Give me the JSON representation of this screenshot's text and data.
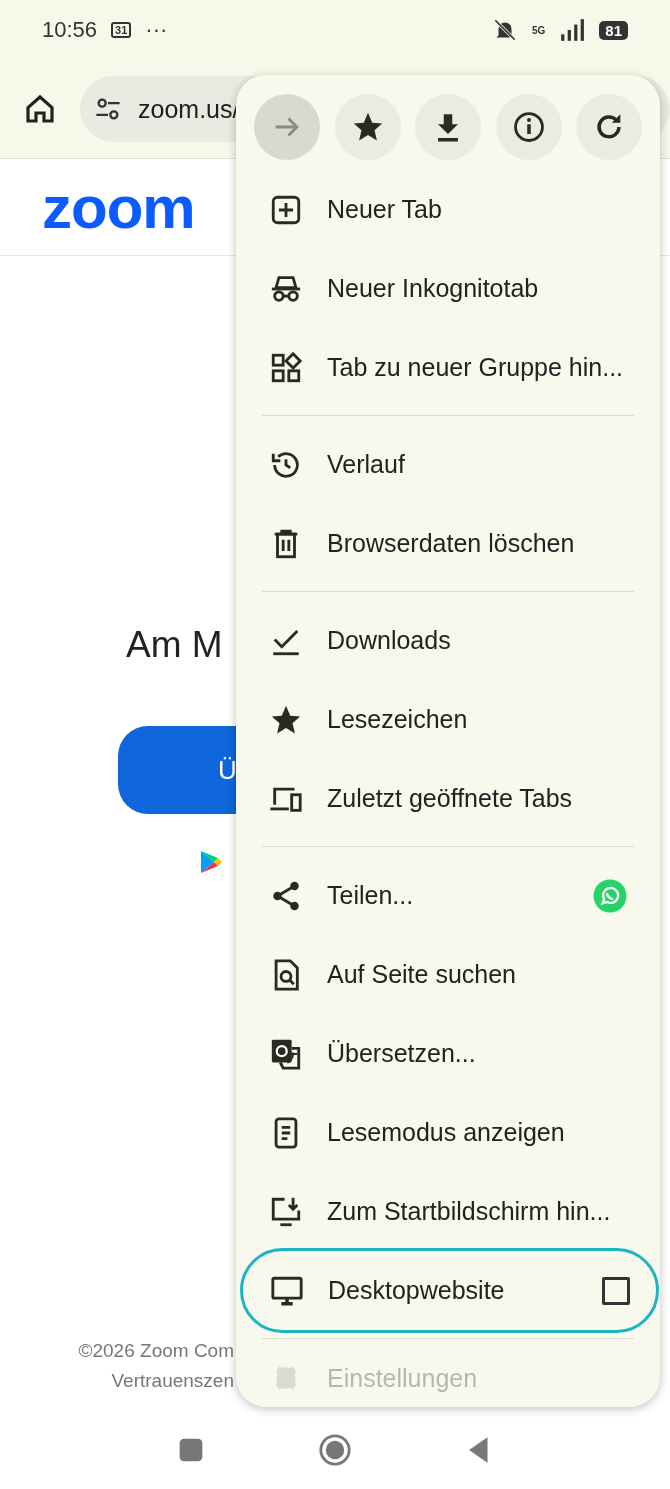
{
  "status_bar": {
    "time": "10:56",
    "calendar": "31",
    "more": "···",
    "network": "5G",
    "battery": "81"
  },
  "toolbar": {
    "url": "zoom.us/"
  },
  "page": {
    "logo": "zoom",
    "heading": "Am M",
    "button": "Ü",
    "footer": [
      "©2026 Zoom Com",
      "Vertrauenszen"
    ]
  },
  "menu": {
    "actions": [
      {
        "kind": "forward",
        "disabled": true
      },
      {
        "kind": "star",
        "disabled": false
      },
      {
        "kind": "download",
        "disabled": false
      },
      {
        "kind": "info",
        "disabled": false
      },
      {
        "kind": "reload",
        "disabled": false
      }
    ],
    "items": [
      {
        "kind": "plus",
        "label": "Neuer Tab",
        "faded": false
      },
      {
        "kind": "incognito",
        "label": "Neuer Inkognitotab",
        "faded": false
      },
      {
        "kind": "group",
        "label": "Tab zu neuer Gruppe hin...",
        "faded": false
      },
      {
        "kind": "divider"
      },
      {
        "kind": "history",
        "label": "Verlauf",
        "faded": false
      },
      {
        "kind": "trash",
        "label": "Browserdaten löschen",
        "faded": false
      },
      {
        "kind": "divider"
      },
      {
        "kind": "check",
        "label": "Downloads",
        "faded": false
      },
      {
        "kind": "star",
        "label": "Lesezeichen",
        "faded": false
      },
      {
        "kind": "devices",
        "label": "Zuletzt geöffnete Tabs",
        "faded": false
      },
      {
        "kind": "divider"
      },
      {
        "kind": "share",
        "label": "Teilen...",
        "faded": false
      },
      {
        "kind": "find",
        "label": "Auf Seite suchen",
        "faded": false
      },
      {
        "kind": "translate",
        "label": "Übersetzen...",
        "faded": false
      },
      {
        "kind": "reader",
        "label": "Lesemodus anzeigen",
        "faded": false
      },
      {
        "kind": "install",
        "label": "Zum Startbildschirm hin...",
        "faded": false
      },
      {
        "kind": "desktop",
        "label": "Desktopwebsite",
        "faded": false,
        "checked": false,
        "highlighted": true
      },
      {
        "kind": "divider"
      },
      {
        "kind": "gear",
        "label": "Einstellungen",
        "faded": true
      }
    ]
  }
}
